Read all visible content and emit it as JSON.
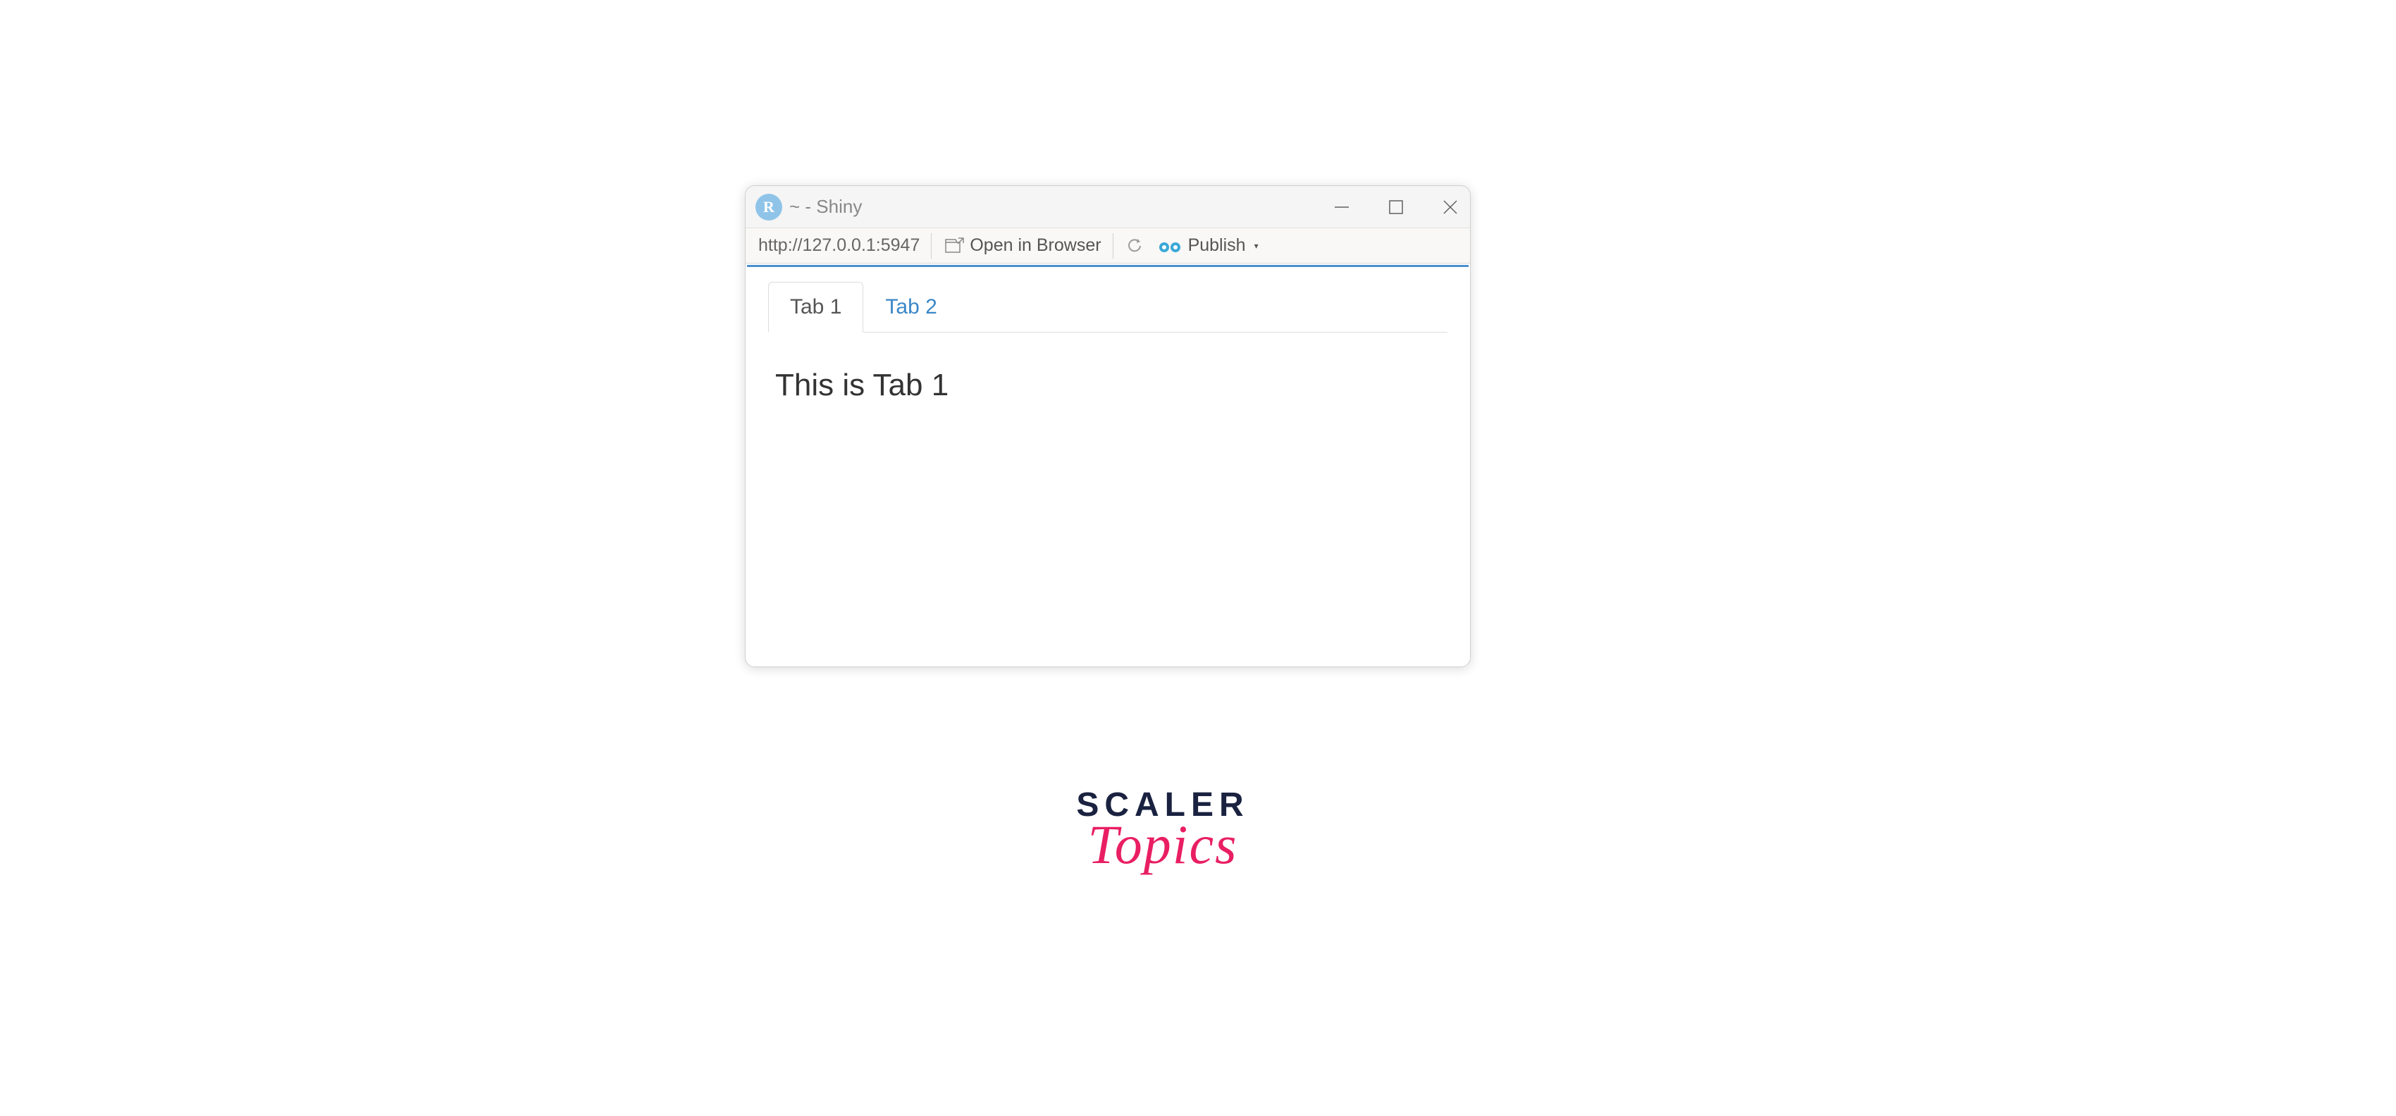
{
  "window": {
    "app_icon_letter": "R",
    "title": "~ - Shiny"
  },
  "toolbar": {
    "url": "http://127.0.0.1:5947",
    "open_in_browser_label": "Open in Browser",
    "publish_label": "Publish"
  },
  "tabs": {
    "tab1_label": "Tab 1",
    "tab2_label": "Tab 2"
  },
  "content": {
    "text": "This is Tab 1"
  },
  "watermark": {
    "line1": "SCALER",
    "line2": "Topics"
  }
}
